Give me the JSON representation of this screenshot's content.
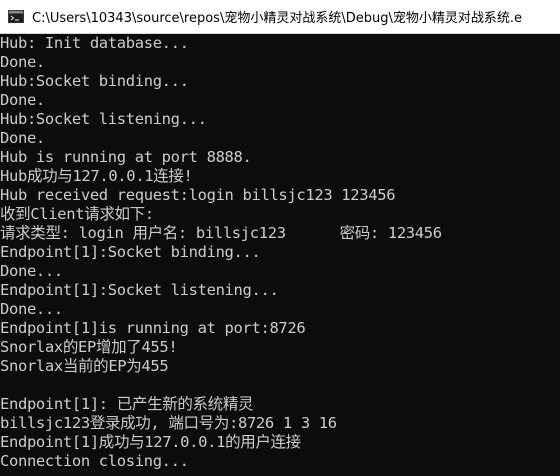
{
  "window": {
    "title": "C:\\Users\\10343\\source\\repos\\宠物小精灵对战系统\\Debug\\宠物小精灵对战系统.e",
    "icon": "console-app-icon",
    "colors": {
      "titlebar_bg": "#ffffff",
      "console_bg": "#0c0c0c",
      "console_text": "#cccccc"
    }
  },
  "console": {
    "lines": [
      "Hub: Init database...",
      "Done.",
      "Hub:Socket binding...",
      "Done.",
      "Hub:Socket listening...",
      "Done.",
      "Hub is running at port 8888.",
      "Hub成功与127.0.0.1连接!",
      "Hub received request:login billsjc123 123456",
      "收到Client请求如下:",
      "请求类型: login 用户名: billsjc123      密码: 123456",
      "Endpoint[1]:Socket binding...",
      "Done...",
      "Endpoint[1]:Socket listening...",
      "Done...",
      "Endpoint[1]is running at port:8726",
      "Snorlax的EP增加了455!",
      "Snorlax当前的EP为455",
      "",
      "Endpoint[1]: 已产生新的系统精灵",
      "billsjc123登录成功, 端口号为:8726 1 3 16",
      "Endpoint[1]成功与127.0.0.1的用户连接",
      "Connection closing..."
    ]
  }
}
